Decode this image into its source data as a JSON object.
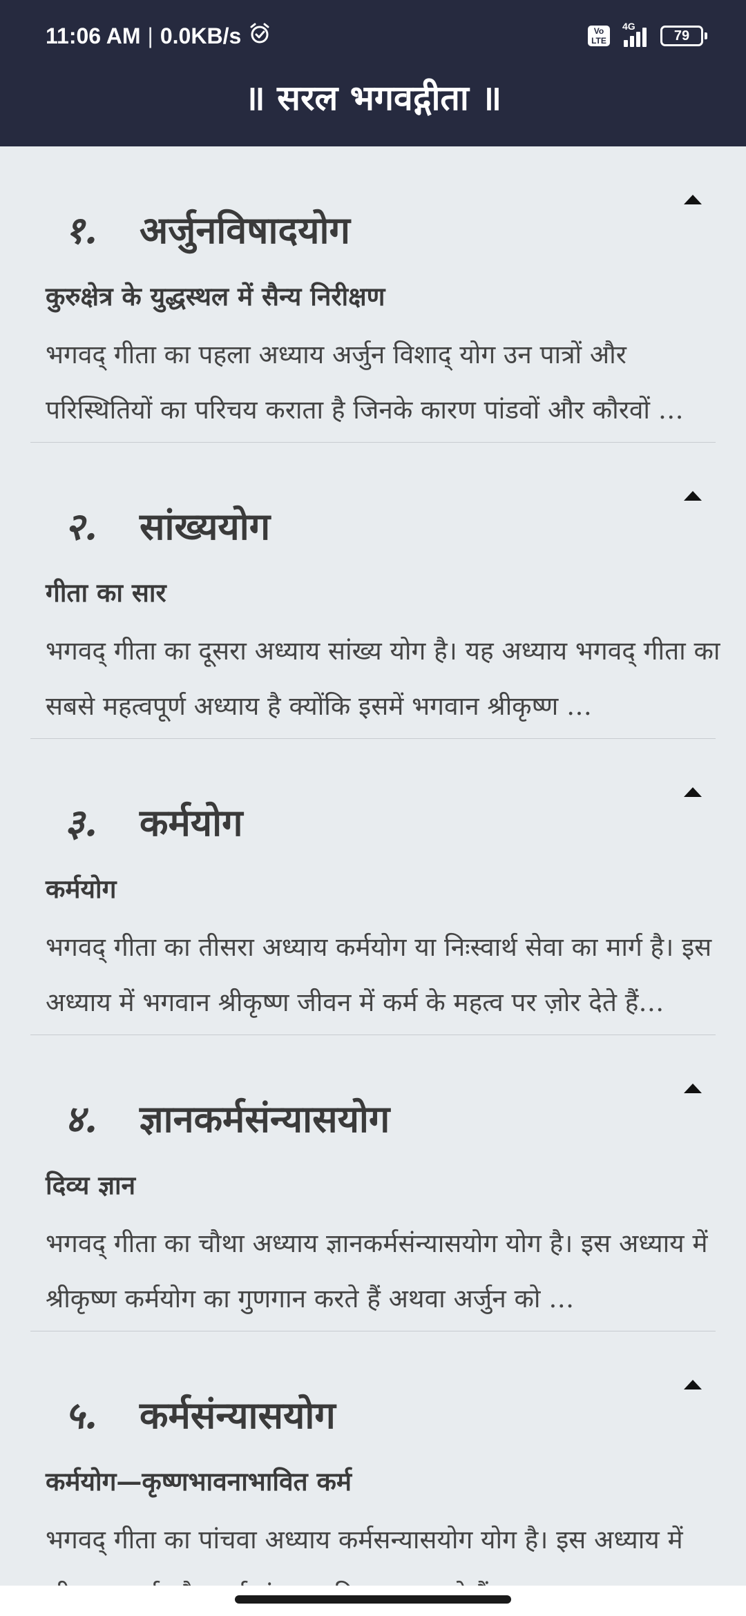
{
  "status_bar": {
    "time": "11:06 AM",
    "separator": "|",
    "speed": "0.0KB/s",
    "alarm_icon": "alarm-clock-icon",
    "volte_line1": "Vo",
    "volte_line2": "LTE",
    "network": "4G",
    "battery": "79"
  },
  "header": {
    "title": "॥ सरल भगवद्गीता ॥",
    "background": "#262a3f"
  },
  "chapters": [
    {
      "num": "१.",
      "name": "अर्जुनविषादयोग",
      "subtitle": "कुरुक्षेत्र के युद्धस्थल में सैन्य निरीक्षण",
      "desc": "भगवद् गीता का पहला अध्याय अर्जुन विशाद् योग उन पात्रों और परिस्थितियों का परिचय कराता है जिनके कारण पांडवों और कौरवों …"
    },
    {
      "num": "२.",
      "name": "सांख्ययोग",
      "subtitle": "गीता का सार",
      "desc": "भगवद् गीता का दूसरा अध्याय सांख्य योग है। यह अध्याय भगवद् गीता का सबसे महत्वपूर्ण अध्याय है क्योंकि इसमें भगवान श्रीकृष्ण …"
    },
    {
      "num": "३.",
      "name": "कर्मयोग",
      "subtitle": "कर्मयोग",
      "desc": "भगवद् गीता का तीसरा अध्याय कर्मयोग या निःस्वार्थ सेवा का मार्ग है। इस अध्याय में भगवान श्रीकृष्ण जीवन में कर्म के महत्व पर ज़ोर देते हैं…"
    },
    {
      "num": "४.",
      "name": "ज्ञानकर्मसंन्यासयोग",
      "subtitle": "दिव्य ज्ञान",
      "desc": "भगवद् गीता का चौथा अध्याय ज्ञानकर्मसंन्यासयोग योग है। इस अध्याय में श्रीकृष्ण कर्मयोग का गुणगान करते हैं अथवा अर्जुन को …"
    },
    {
      "num": "५.",
      "name": "कर्मसंन्यासयोग",
      "subtitle": "कर्मयोग—कृष्णभावनाभावित कर्म",
      "desc": "भगवद् गीता का पांचवा अध्याय कर्मसन्यासयोग योग है। इस अध्याय में श्रीकृष्ण कर्म और कर्म संन्यास की तुलना करते हैं"
    }
  ],
  "collapse_icon": "caret-up-icon"
}
